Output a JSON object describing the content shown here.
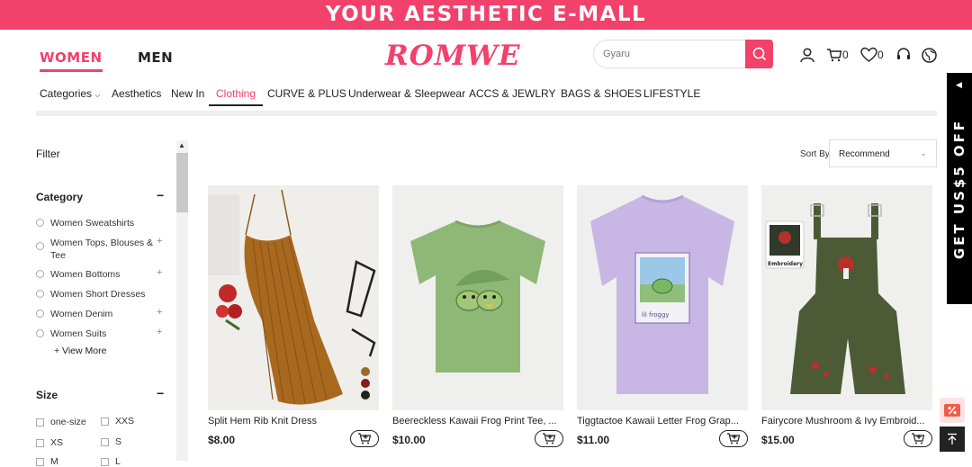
{
  "promo_banner": "YOUR AESTHETIC E-MALL",
  "header": {
    "women_tab": "WOMEN",
    "men_tab": "MEN",
    "logo": "ROMWE",
    "search_placeholder": "Gyaru",
    "cart_count": "0",
    "wishlist_count": "0"
  },
  "nav": {
    "items": [
      "Categories",
      "Aesthetics",
      "New In",
      "Clothing",
      "CURVE & PLUS",
      "Underwear & Sleepwear",
      "ACCS & JEWLRY",
      "BAGS & SHOES",
      "LIFESTYLE"
    ],
    "active": "Clothing"
  },
  "sidebar": {
    "filter_title": "Filter",
    "category_title": "Category",
    "categories": [
      "Women Sweatshirts",
      "Women Tops, Blouses & Tee",
      "Women Bottoms",
      "Women Short Dresses",
      "Women Denim",
      "Women Suits"
    ],
    "view_more": "+ View More",
    "size_title": "Size",
    "sizes": [
      "one-size",
      "XXS",
      "XS",
      "S",
      "M",
      "L"
    ]
  },
  "sort": {
    "label": "Sort By",
    "value": "Recommend"
  },
  "products": [
    {
      "name": "Split Hem Rib Knit Dress",
      "price": "$8.00"
    },
    {
      "name": "Beereckless Kawaii Frog Print Tee, ...",
      "price": "$10.00"
    },
    {
      "name": "Tiggtactoe Kawaii Letter Frog Grap...",
      "price": "$11.00"
    },
    {
      "name": "Fairycore Mushroom & Ivy Embroid...",
      "price": "$15.00"
    }
  ],
  "product_badges": {
    "embroidery": "Embroidery",
    "froggy": "lil froggy"
  },
  "side_promo": "GET US$5 OFF",
  "colors": {
    "brand": "#f2416b",
    "dark": "#222222"
  }
}
